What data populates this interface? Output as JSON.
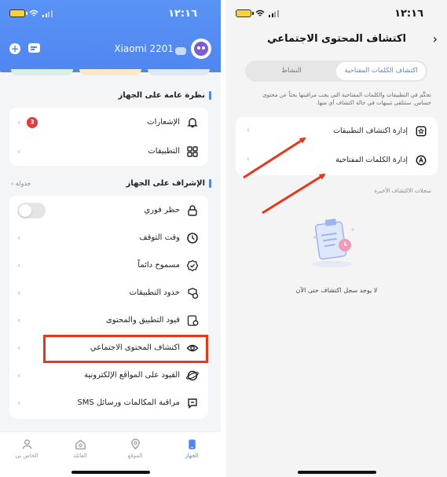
{
  "left": {
    "status": {
      "time": "١٢:١٦"
    },
    "header": {
      "device_name": "Xiaomi 2201",
      "add_icon": "plus-icon",
      "message_icon": "message-icon"
    },
    "overview": {
      "title": "نظرة عامة على الجهاز",
      "items": [
        {
          "label": "الإشعارات",
          "badge": "3",
          "icon": "bell-icon"
        },
        {
          "label": "التطبيقات",
          "icon": "apps-grid-icon"
        }
      ]
    },
    "supervision": {
      "title": "الإشراف على الجهاز",
      "link": "جدولة",
      "items": [
        {
          "label": "حظر فوري",
          "icon": "lock-icon",
          "toggle": false
        },
        {
          "label": "وقت التوقف",
          "icon": "clock-icon"
        },
        {
          "label": "مسموح دائماً",
          "icon": "badge-check-icon"
        },
        {
          "label": "حدود التطبيقات",
          "icon": "app-limit-icon"
        },
        {
          "label": "قيود التطبيق والمحتوى",
          "icon": "content-restrict-icon"
        },
        {
          "label": "اكتشاف المحتوى الاجتماعي",
          "icon": "eye-icon"
        },
        {
          "label": "القيود على المواقع الإلكترونية",
          "icon": "globe-icon"
        },
        {
          "label": "مراقبة المكالمات ورسائل SMS",
          "icon": "chat-icon"
        }
      ]
    },
    "tabs": [
      {
        "label": "الخاص بي",
        "icon": "user-icon"
      },
      {
        "label": "العائلة",
        "icon": "home-icon"
      },
      {
        "label": "الموقع",
        "icon": "location-icon"
      },
      {
        "label": "الجهاز",
        "icon": "device-icon"
      }
    ],
    "colors": {
      "primary": "#4f86f0",
      "highlight": "#e8361c",
      "badge": "#e53935"
    }
  },
  "right": {
    "status": {
      "time": "١٢:١٦"
    },
    "title": "اكتشاف المحتوى الاجتماعي",
    "segments": {
      "active": "اكتشاف الكلمات المفتاحية",
      "inactive": "النشاط"
    },
    "description": "تحكّم في التطبيقات والكلمات المفتاحية التي يجب مراقبتها بحثاً عن محتوى حساس. ستتلقى تنبيهات في حالة اكتشاف أي منها.",
    "items": [
      {
        "label": "إدارة اكتشاف التطبيقات",
        "icon": "app-scan-icon"
      },
      {
        "label": "إدارة الكلمات المفتاحية",
        "icon": "keyword-icon"
      }
    ],
    "history_title": "سجلات الاكتشاف الأخيرة",
    "empty_text": "لا يوجد سجل اكتشاف حتى الآن",
    "colors": {
      "primary": "#4f86f0",
      "arrow": "#e8361c"
    }
  }
}
